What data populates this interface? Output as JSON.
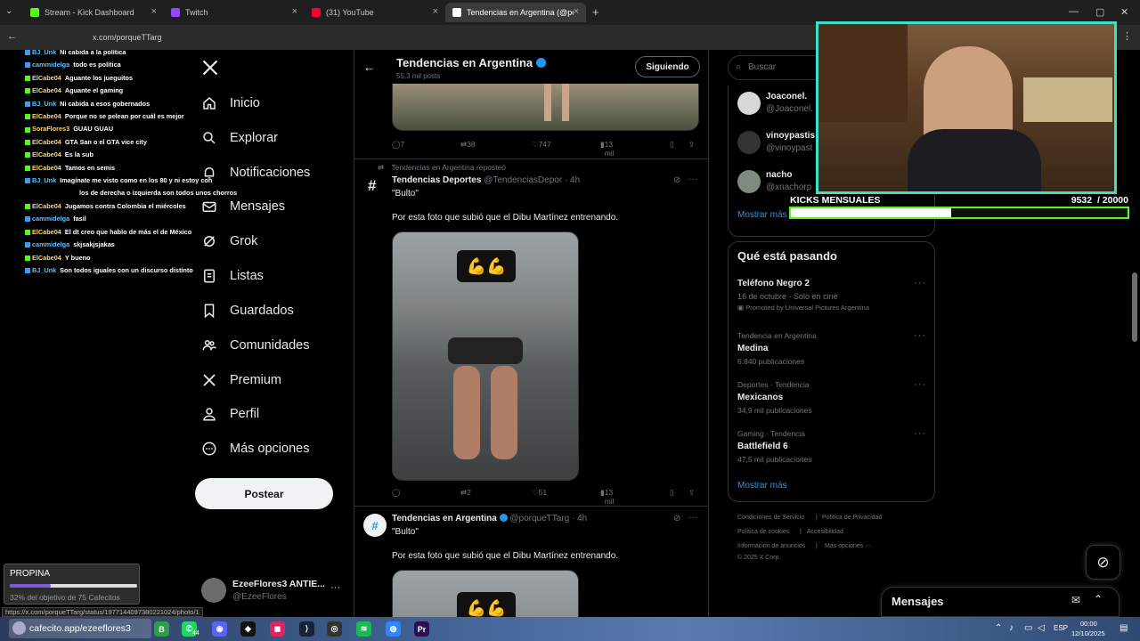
{
  "browser": {
    "tabs": [
      {
        "label": "Stream - Kick Dashboard",
        "color": "#53fc18"
      },
      {
        "label": "Twitch",
        "color": "#9146ff"
      },
      {
        "label": "(31) YouTube",
        "color": "#ff0033"
      },
      {
        "label": "Tendencias en Argentina (@por",
        "color": "#ffffff"
      }
    ],
    "url": "x.com/porqueTTarg",
    "status_url": "https://x.com/porqueTTarg/status/1977144097380221024/photo/1"
  },
  "chat": [
    {
      "user": "BJ_Unk",
      "text": "Ni cabida a la política",
      "color": "blue"
    },
    {
      "user": "cammidelga",
      "text": "todo es política",
      "color": "blue"
    },
    {
      "user": "ElCabe04",
      "text": "Aguante los jueguitos",
      "color": "gold"
    },
    {
      "user": "ElCabe04",
      "text": "Aguante el gaming",
      "color": "gold"
    },
    {
      "user": "BJ_Unk",
      "text": "Ni cabida a esos gobernados",
      "color": "blue"
    },
    {
      "user": "ElCabe04",
      "text": "Porque no se pelean por cuál es mejor",
      "color": "gold"
    },
    {
      "user": "SoraFlores3",
      "text": "GUAU GUAU",
      "color": "gold"
    },
    {
      "user": "ElCabe04",
      "text": "GTA San o el GTA vice city",
      "color": "gold"
    },
    {
      "user": "ElCabe04",
      "text": "Es la sub",
      "color": "gold"
    },
    {
      "user": "ElCabe04",
      "text": "Tamos en semis",
      "color": "gold"
    },
    {
      "user": "BJ_Unk",
      "text": "Imagínate me visto como en los 80 y ni estoy con",
      "color": "blue"
    },
    {
      "user": "",
      "text": "los de derecha o izquierda son todos unos chorros",
      "color": "blue"
    },
    {
      "user": "ElCabe04",
      "text": "Jugamos contra Colombia el miércoles",
      "color": "gold"
    },
    {
      "user": "cammidelga",
      "text": "fasil",
      "color": "blue"
    },
    {
      "user": "ElCabe04",
      "text": "El dt creo que hablo de más el de México",
      "color": "gold"
    },
    {
      "user": "cammidelga",
      "text": "skjsakjsjakas",
      "color": "blue"
    },
    {
      "user": "ElCabe04",
      "text": "Y bueno",
      "color": "gold"
    },
    {
      "user": "BJ_Unk",
      "text": "Son todos iguales con un discurso distinto",
      "color": "blue"
    }
  ],
  "nav": {
    "items": [
      {
        "label": "Inicio",
        "icon": "home-icon"
      },
      {
        "label": "Explorar",
        "icon": "search-icon"
      },
      {
        "label": "Notificaciones",
        "icon": "bell-icon"
      },
      {
        "label": "Mensajes",
        "icon": "mail-icon"
      },
      {
        "label": "Grok",
        "icon": "grok-icon"
      },
      {
        "label": "Listas",
        "icon": "list-icon"
      },
      {
        "label": "Guardados",
        "icon": "bookmark-icon"
      },
      {
        "label": "Comunidades",
        "icon": "people-icon"
      },
      {
        "label": "Premium",
        "icon": "x-logo-icon"
      },
      {
        "label": "Perfil",
        "icon": "person-icon"
      },
      {
        "label": "Más opciones",
        "icon": "more-circle-icon"
      }
    ],
    "post_label": "Postear",
    "account_name": "EzeeFlores3 ANTIE...",
    "account_handle": "@EzeeFlores"
  },
  "header": {
    "title": "Tendencias en Argentina",
    "subtitle": "55,3 mil posts",
    "follow_label": "Siguiendo"
  },
  "post0": {
    "replies": "7",
    "reposts": "38",
    "likes": "747",
    "views": "13 mil"
  },
  "post1": {
    "repost_note": "Tendencias en Argentina reposteó",
    "author": "Tendencias Deportes",
    "handle": "@TendenciasDepor",
    "time": "· 4h",
    "line1": "\"Bulto\"",
    "line2": "Por esta foto que subió que el Dibu Martínez entrenando.",
    "replies": "",
    "reposts": "2",
    "likes": "51",
    "views": "13 mil"
  },
  "post2": {
    "author": "Tendencias en Argentina",
    "handle": "@porqueTTarg",
    "time": "· 4h",
    "line1": "\"Bulto\"",
    "line2": "Por esta foto que subió que el Dibu Martínez entrenando."
  },
  "search": {
    "placeholder": "Buscar"
  },
  "who_to_follow": [
    {
      "name": "Joaconel.",
      "handle": "@Joaconel."
    },
    {
      "name": "vinoypastis",
      "handle": "@vinoypast"
    },
    {
      "name": "nacho",
      "handle": "@xnachorp"
    }
  ],
  "show_more": "Mostrar más",
  "trends": {
    "title": "Qué está pasando",
    "promo": {
      "name": "Teléfono Negro 2",
      "sub": "16 de octubre - Solo en cine",
      "promoted": "Promoted by Universal Pictures Argentina"
    },
    "items": [
      {
        "meta": "Tendencia en Argentina",
        "name": "Medina",
        "count": "6.840 publicaciones"
      },
      {
        "meta": "Deportes · Tendencia",
        "name": "Mexicanos",
        "count": "34,9 mil publicaciones"
      },
      {
        "meta": "Gaming · Tendencia",
        "name": "Battlefield 6",
        "count": "47,5 mil publicaciones"
      }
    ],
    "show_more": "Mostrar más"
  },
  "footer": {
    "l1a": "Condiciones de Servicio",
    "l1b": "Política de Privacidad",
    "l2a": "Política de cookies",
    "l2b": "Accesibilidad",
    "l3a": "Información de anuncios",
    "l3b": "Más opciones ···",
    "copy": "© 2025 X Corp."
  },
  "overlay": {
    "kicks_label": "KICKS MENSUALES",
    "kicks_value": "9532",
    "kicks_goal": "/ 20000",
    "kicks_fraction": 0.4766
  },
  "propina": {
    "title": "PROPINA",
    "progress": "32% del objetivo de 75 Cafecitos",
    "progress_fraction": 0.32,
    "link": "cafecito.app/ezeeflores3"
  },
  "messages": {
    "title": "Mensajes"
  },
  "taskbar": {
    "lang": "ESP",
    "time": "00:00",
    "date": "12/10/2025",
    "badge": "44"
  }
}
